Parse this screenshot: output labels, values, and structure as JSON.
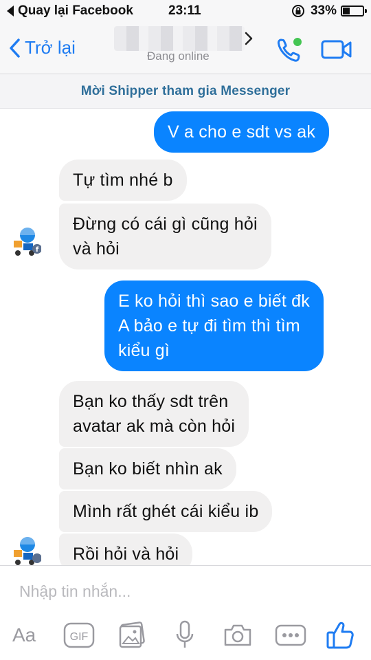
{
  "status_bar": {
    "back_app": "Quay lại Facebook",
    "time": "23:11",
    "battery": "33%",
    "battery_level": 0.33
  },
  "nav": {
    "back_label": "Trở lại",
    "status": "Đang online"
  },
  "banner": {
    "text": "Mời Shipper tham gia Messenger"
  },
  "messages": [
    {
      "from": "me",
      "text": "V a cho e sdt vs ak"
    },
    {
      "from": "them",
      "text": "Tự tìm nhé b"
    },
    {
      "from": "them",
      "text": "Đừng có cái gì cũng hỏi\nvà hỏi"
    },
    {
      "from": "me",
      "text": "E ko hỏi thì sao e biết đk\nA bảo e tự đi tìm thì tìm\nkiểu gì"
    },
    {
      "from": "them",
      "text": "Bạn ko thấy sdt trên\navatar ak mà còn hỏi"
    },
    {
      "from": "them",
      "text": "Bạn ko biết nhìn ak"
    },
    {
      "from": "them",
      "text": "Mình rất ghét cái kiểu ib"
    },
    {
      "from": "them",
      "text": "Rồi hỏi và hỏi"
    }
  ],
  "composer": {
    "placeholder": "Nhập tin nhắn...",
    "aa_label": "Aa",
    "gif_label": "GIF"
  },
  "colors": {
    "accent": "#1f7cf2",
    "outgoing_bubble": "#0a84ff",
    "incoming_bubble": "#f1f0f0",
    "online_dot": "#44c553"
  },
  "icons": [
    "back-chevron-icon",
    "phone-icon",
    "video-camera-icon",
    "gif-icon",
    "image-icon",
    "microphone-icon",
    "camera-icon",
    "more-icon",
    "thumbs-up-icon"
  ]
}
